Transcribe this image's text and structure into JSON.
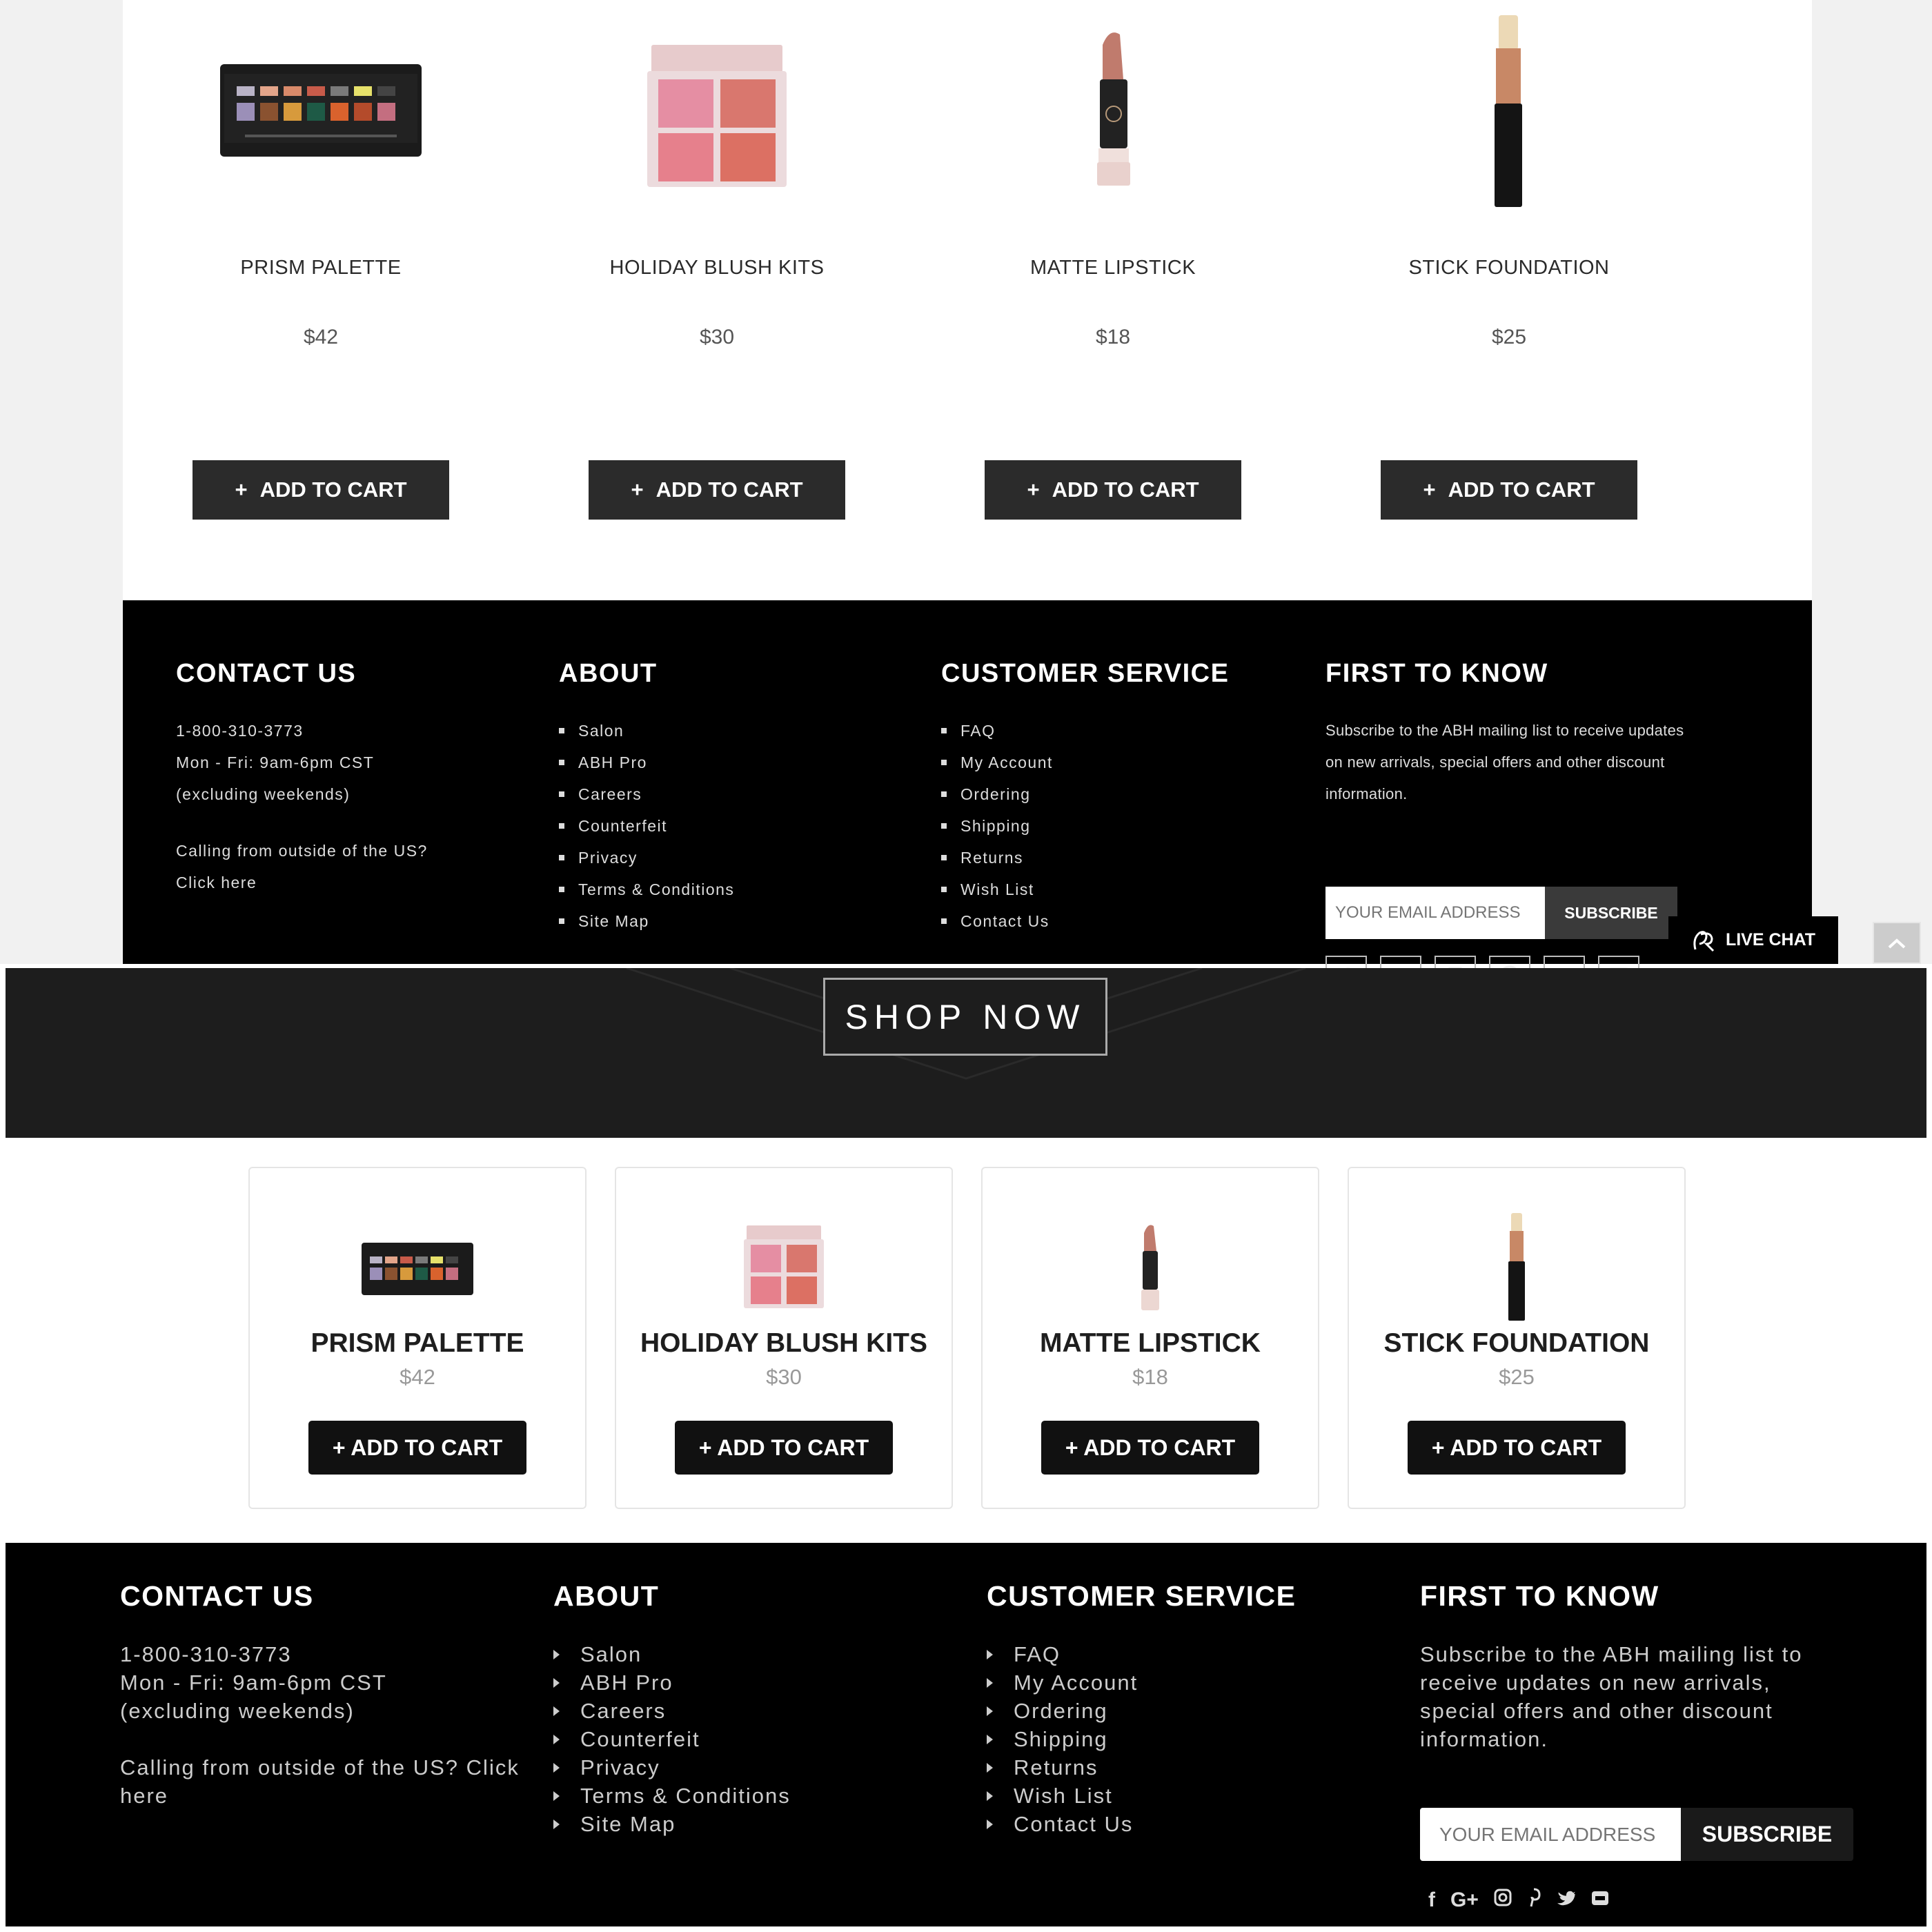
{
  "products": [
    {
      "name": "PRISM PALETTE",
      "price": "$42"
    },
    {
      "name": "HOLIDAY BLUSH KITS",
      "price": "$30"
    },
    {
      "name": "MATTE LIPSTICK",
      "price": "$18"
    },
    {
      "name": "STICK FOUNDATION",
      "price": "$25"
    }
  ],
  "top_add_to_cart": "ADD TO CART",
  "bottom_add_to_cart": "+ ADD TO CART",
  "shop_now": "SHOP NOW",
  "footer": {
    "contact": {
      "title": "CONTACT US",
      "phone": "1-800-310-3773",
      "hours": "Mon - Fri: 9am-6pm CST",
      "hours_note": "(excluding weekends)",
      "outside_us_top_line1": "Calling from outside of the US?",
      "outside_us_top_line2": "Click here",
      "outside_us_bottom": "Calling from outside of the US? Click here"
    },
    "about": {
      "title": "ABOUT",
      "items": [
        "Salon",
        "ABH Pro",
        "Careers",
        "Counterfeit",
        "Privacy",
        "Terms & Conditions",
        "Site Map"
      ]
    },
    "customer_service": {
      "title": "CUSTOMER SERVICE",
      "items": [
        "FAQ",
        "My Account",
        "Ordering",
        "Shipping",
        "Returns",
        "Wish List",
        "Contact Us"
      ]
    },
    "first_to_know": {
      "title": "FIRST TO KNOW",
      "top_line1": "Subscribe to the ABH mailing list to receive updates",
      "top_line2": "on new arrivals, special offers and other discount",
      "top_line3": "information.",
      "bottom_text": "Subscribe to the ABH mailing list to receive updates on new arrivals, special offers and other discount information.",
      "email_placeholder": "YOUR EMAIL ADDRESS",
      "subscribe_top": "SUBSCRIBE",
      "subscribe_bottom": "SUBSCRIBE"
    },
    "social_icons": [
      "facebook-icon",
      "google-plus-icon",
      "instagram-icon",
      "pinterest-icon",
      "twitter-icon",
      "youtube-icon"
    ]
  },
  "live_chat": "LIVE CHAT",
  "colors": {
    "footer_bg": "#000000",
    "button_bg": "#2b2b2b",
    "banner_bg": "#1d1d1d"
  }
}
